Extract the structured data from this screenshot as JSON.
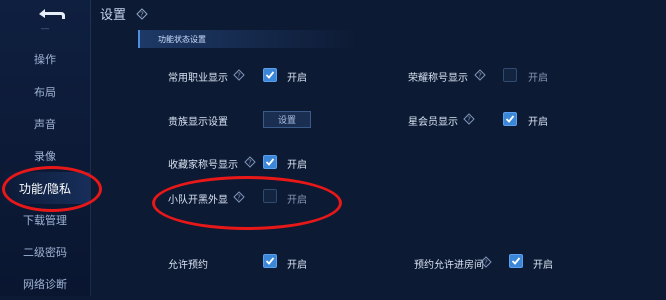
{
  "header": {
    "title": "设置"
  },
  "sidebar": {
    "items": [
      {
        "label": "操作"
      },
      {
        "label": "布局"
      },
      {
        "label": "声音"
      },
      {
        "label": "录像"
      },
      {
        "label": "功能/隐私"
      },
      {
        "label": "下载管理"
      },
      {
        "label": "二级密码"
      },
      {
        "label": "网络诊断"
      }
    ]
  },
  "section": {
    "title": "功能状态设置"
  },
  "settings": {
    "common_job": {
      "label": "常用职业显示",
      "state": "开启",
      "checked": true
    },
    "honor_title": {
      "label": "荣耀称号显示",
      "state": "开启",
      "checked": false
    },
    "noble": {
      "label": "贵族显示设置",
      "button": "设置"
    },
    "star_member": {
      "label": "星会员显示",
      "state": "开启",
      "checked": true
    },
    "collector_title": {
      "label": "收藏家称号显示",
      "state": "开启",
      "checked": true
    },
    "team_blacklist": {
      "label": "小队开黑外显",
      "state": "开启",
      "checked": false
    },
    "allow_booking": {
      "label": "允许预约",
      "state": "开启",
      "checked": true
    },
    "booking_room": {
      "label": "预约允许进房间",
      "state": "开启",
      "checked": true
    }
  },
  "colors": {
    "accent": "#3c86d8",
    "annotation": "#e81818",
    "background": "#0d1a33"
  }
}
